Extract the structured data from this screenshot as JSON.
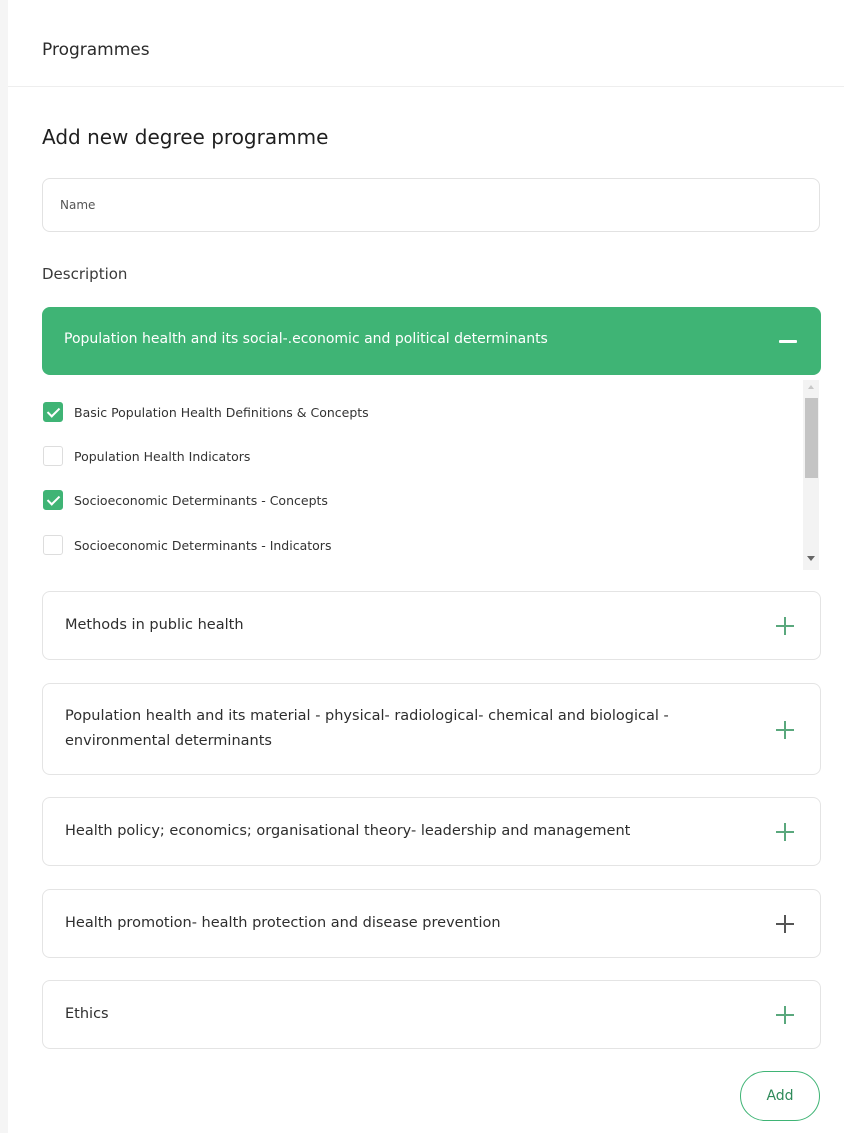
{
  "header": {
    "breadcrumb": "Programmes"
  },
  "form": {
    "title": "Add new degree programme",
    "name_placeholder": "Name",
    "name_value": "",
    "description_label": "Description",
    "add_button_label": "Add"
  },
  "accordion": {
    "open_section": {
      "title": "Population health and its social-.economic and political determinants",
      "items": [
        {
          "label": "Basic Population Health Definitions & Concepts",
          "checked": true
        },
        {
          "label": "Population Health Indicators",
          "checked": false
        },
        {
          "label": "Socioeconomic Determinants - Concepts",
          "checked": true
        },
        {
          "label": "Socioeconomic Determinants - Indicators",
          "checked": false
        }
      ]
    },
    "closed_sections": [
      {
        "title": "Methods in public health"
      },
      {
        "title": "Population health and its material - physical- radiological- chemical and biological - environmental determinants"
      },
      {
        "title": "Health policy; economics; organisational theory- leadership and management"
      },
      {
        "title": "Health promotion- health protection and disease prevention"
      },
      {
        "title": "Ethics"
      }
    ]
  },
  "colors": {
    "accent": "#3fb475",
    "border": "#e4e4e4",
    "text": "#2b2b2b"
  },
  "icons": {
    "expanded": "minus-icon",
    "collapsed": "plus-icon",
    "checkbox_checked": "check-icon"
  }
}
